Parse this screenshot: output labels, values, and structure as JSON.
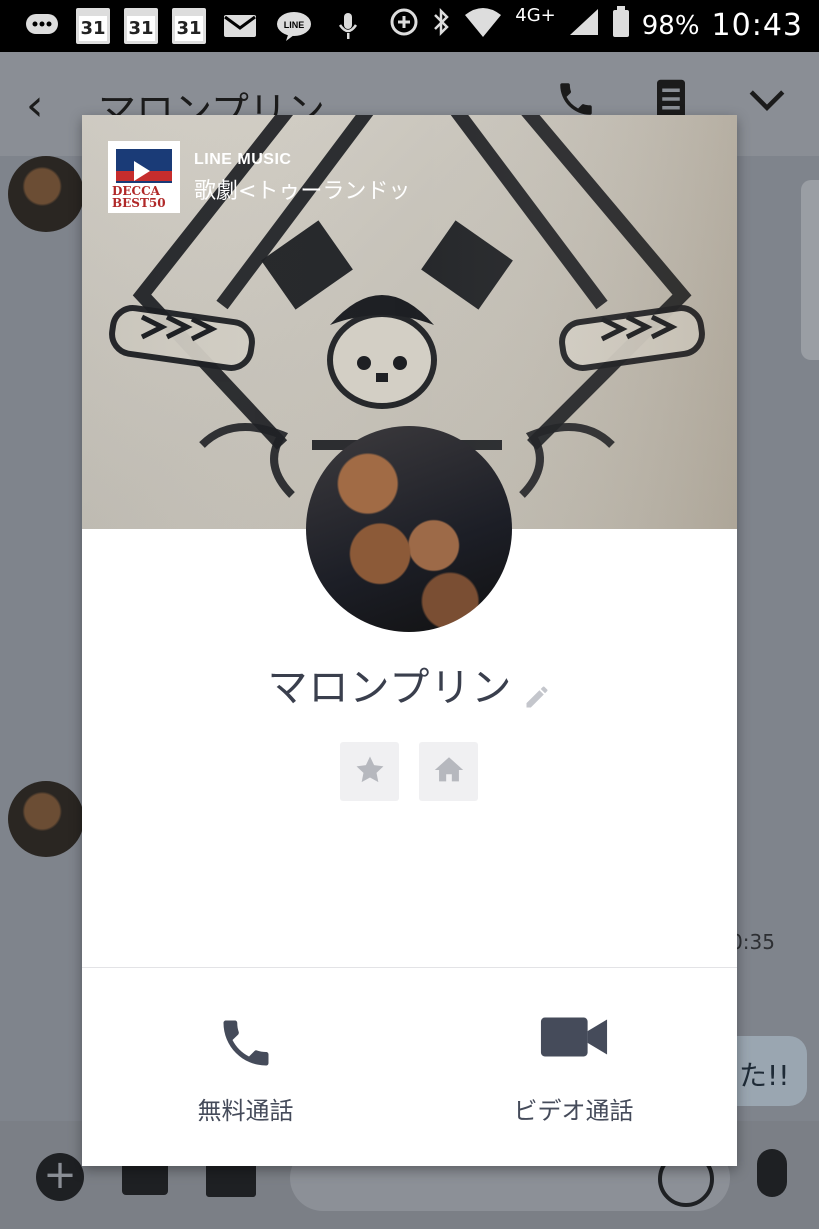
{
  "status_bar": {
    "calendar_day": "31",
    "network": "4G+",
    "battery": "98%",
    "time": "10:43"
  },
  "chat": {
    "title": "マロンプリン",
    "last_time": "0:35",
    "bubble_text": "た!!"
  },
  "profile": {
    "music_label": "LINE MUSIC",
    "music_title": "歌劇<トゥーランドッ",
    "thumb_text": "DECCA BEST50",
    "name": "マロンプリン",
    "buttons": {
      "voice_call": "無料通話",
      "video_call": "ビデオ通話"
    }
  },
  "icons": {
    "favorite": "star-icon",
    "home": "home-icon",
    "edit": "pencil-icon",
    "voice": "phone-icon",
    "video": "video-camera-icon"
  },
  "colors": {
    "accent": "#454b5a",
    "overlay": "#7b7f86"
  }
}
